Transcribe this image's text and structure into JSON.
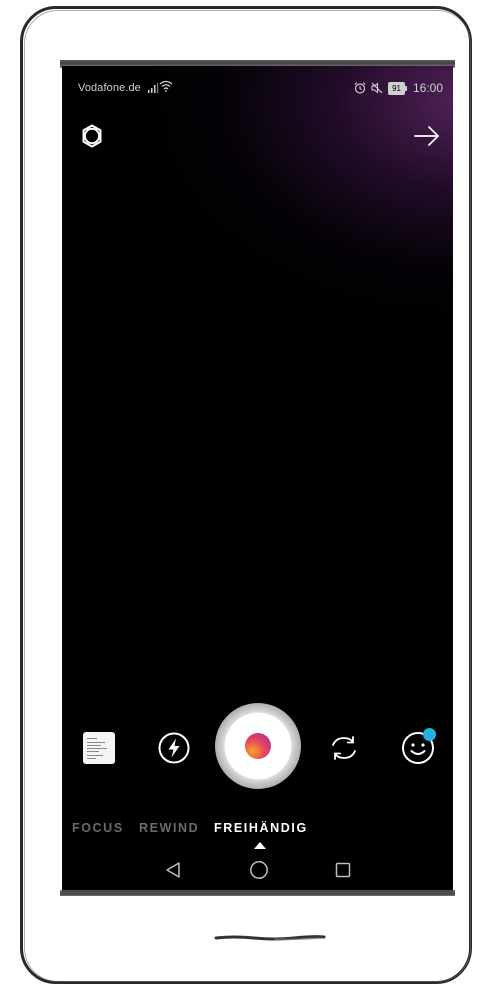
{
  "status_bar": {
    "carrier": "Vodafone.de",
    "battery": "91",
    "time": "16:00"
  },
  "top_bar": {
    "settings_icon": "settings-ring-icon",
    "next_icon": "arrow-right-icon"
  },
  "controls": {
    "gallery_icon": "gallery-thumbnail",
    "flash_icon": "flash-off-icon",
    "shutter_icon": "record-shutter",
    "switch_camera_icon": "switch-camera-icon",
    "face_effects_icon": "face-effects-icon"
  },
  "modes": {
    "tabs": [
      "FOCUS",
      "REWIND",
      "FREIHÄNDIG"
    ],
    "active": "FREIHÄNDIG"
  },
  "nav": {
    "back_icon": "triangle-back-icon",
    "home_icon": "circle-home-icon",
    "recents_icon": "square-recents-icon"
  },
  "colors": {
    "screen_background": "#000000",
    "glow": "#6e2d78",
    "record_gradient_start": "#f5a623",
    "record_gradient_mid": "#e8465d",
    "record_gradient_end": "#833ab4",
    "notify_dot": "#20b2e3",
    "inactive_tab": "#6b6b6b",
    "active_tab": "#ffffff"
  }
}
